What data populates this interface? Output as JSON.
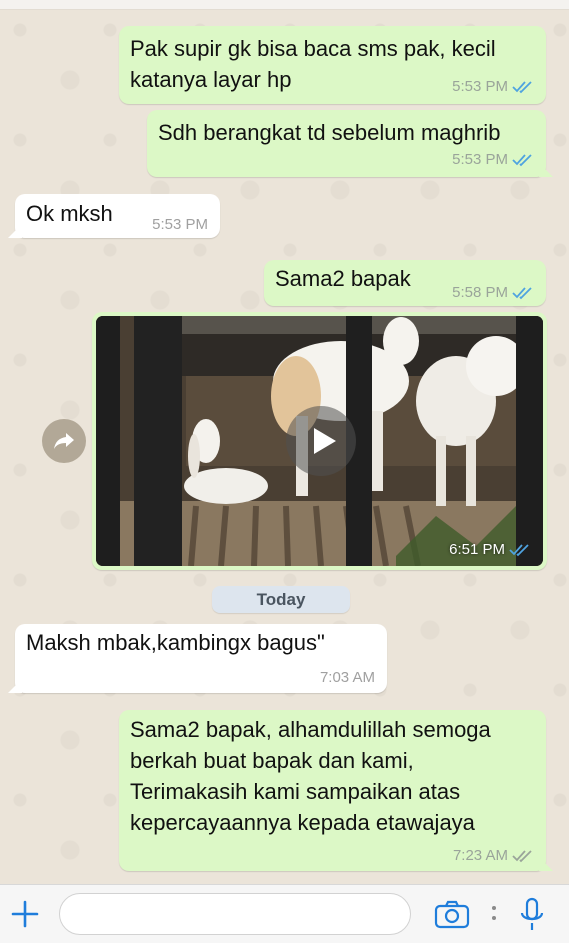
{
  "messages": [
    {
      "text_lines": [
        "Pak supir gk bisa baca sms pak, kecil",
        "katanya layar hp"
      ],
      "time": "5:53 PM",
      "direction": "out",
      "status": "read"
    },
    {
      "text_lines": [
        "Sdh berangkat td sebelum maghrib"
      ],
      "time": "5:53 PM",
      "direction": "out",
      "status": "read"
    },
    {
      "text_lines": [
        "Ok mksh"
      ],
      "time": "5:53 PM",
      "direction": "in"
    },
    {
      "text_lines": [
        "Sama2 bapak"
      ],
      "time": "5:58 PM",
      "direction": "out",
      "status": "read"
    },
    {
      "text_lines": [
        "Maksh mbak,kambingx bagus\""
      ],
      "time": "7:03 AM",
      "direction": "in"
    },
    {
      "text_lines": [
        "Sama2 bapak, alhamdulillah semoga",
        "berkah buat bapak dan kami,",
        "Terimakasih kami sampaikan atas",
        "kepercayaannya kepada etawajaya"
      ],
      "time": "7:23 AM",
      "direction": "out",
      "status": "delivered"
    }
  ],
  "video_message": {
    "time": "6:51 PM",
    "status": "read",
    "icon": "play-icon"
  },
  "date_separator": "Today",
  "input_bar": {
    "placeholder": "",
    "icons": [
      "plus-icon",
      "camera-icon",
      "more-dots-icon",
      "microphone-icon"
    ]
  },
  "colors": {
    "outgoing_bubble": "#dcf8c6",
    "incoming_bubble": "#ffffff",
    "read_ticks": "#4fa3e0",
    "accent": "#1f7ddb"
  }
}
